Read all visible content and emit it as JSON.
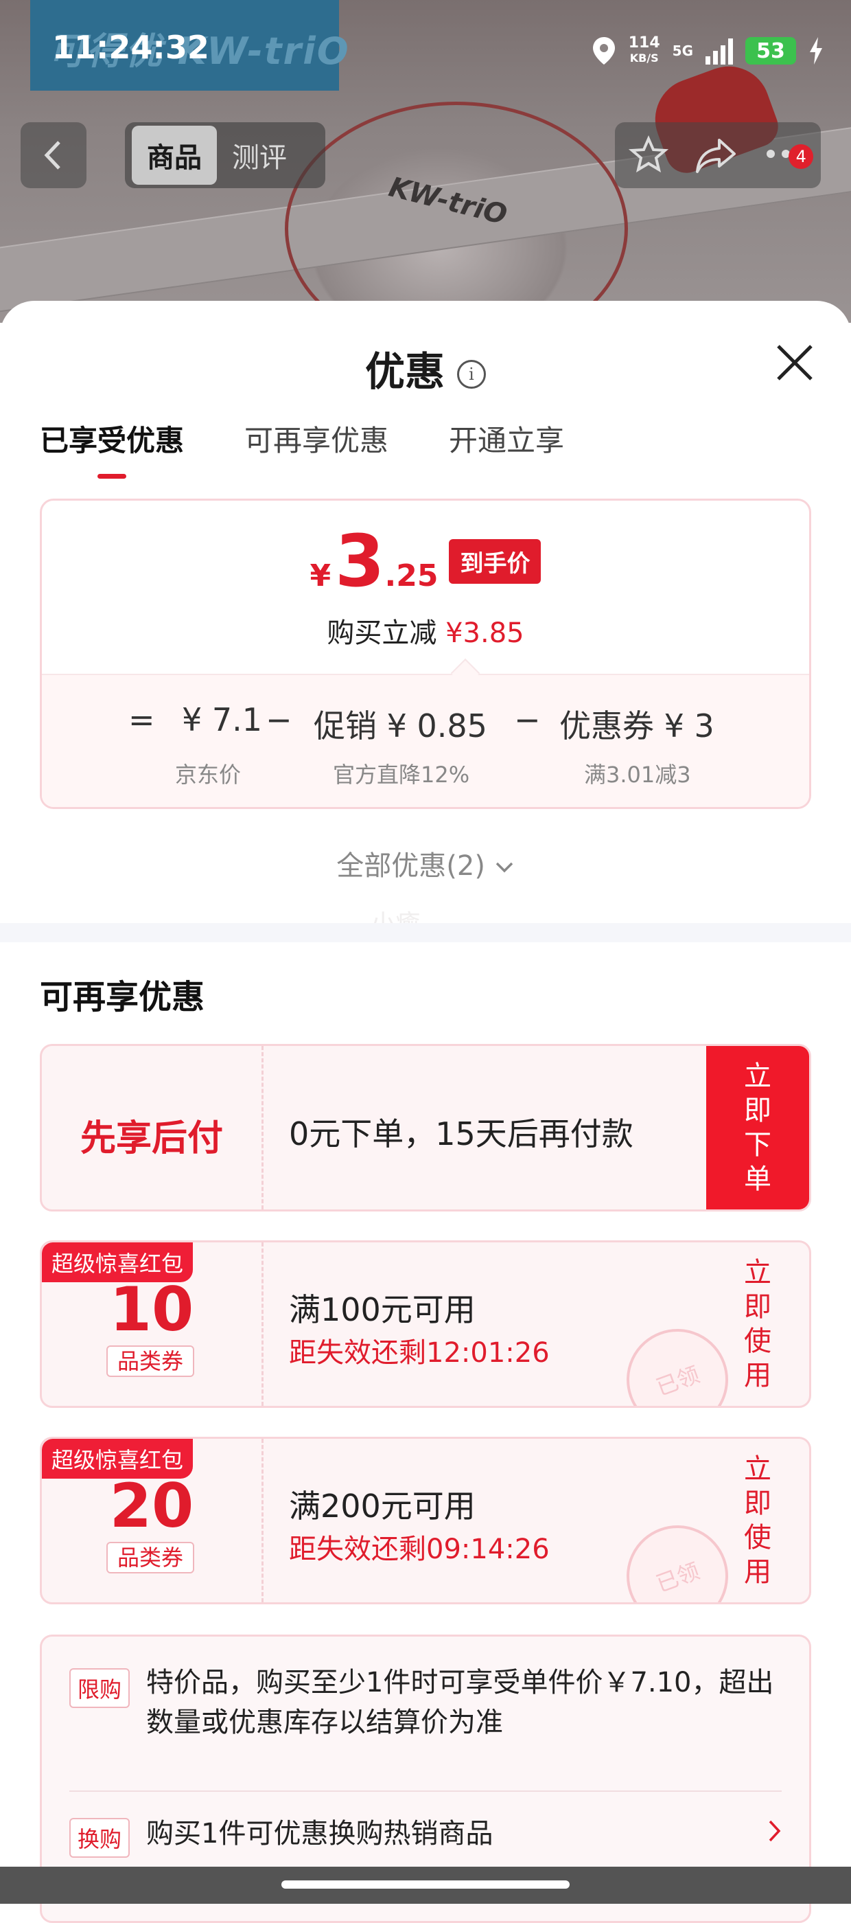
{
  "status_bar": {
    "time": "11:24:32",
    "net_speed": "114",
    "net_unit": "KB/S",
    "signal_label": "5G",
    "battery": "53"
  },
  "header": {
    "tabs": [
      "商品",
      "测评"
    ],
    "active_tab": "商品",
    "notification_count": "4",
    "brand_text": "可得优 KW-triO",
    "product_logo": "KW-triO"
  },
  "sheet": {
    "title": "优惠",
    "tabs": [
      "已享受优惠",
      "可再享优惠",
      "开通立享"
    ],
    "active_tab_index": 0
  },
  "price_card": {
    "currency": "¥",
    "price_int": "3",
    "price_dec": ".25",
    "price_tag": "到手价",
    "reduce_label": "购买立减",
    "reduce_amount": "¥3.85",
    "equals": "=",
    "minus": "−",
    "items": [
      {
        "value": "¥ 7.1",
        "label": "京东价"
      },
      {
        "value": "促销 ¥ 0.85",
        "label": "官方直降12%"
      },
      {
        "value": "优惠券 ¥ 3",
        "label": "满3.01减3"
      }
    ]
  },
  "all_offers": "全部优惠(2)",
  "watermark": "小癒",
  "extra_section": {
    "title": "可再享优惠",
    "pay_later": {
      "title": "先享后付",
      "desc": "0元下单，15天后再付款",
      "action": "立即下单"
    },
    "coupons": [
      {
        "tag": "超级惊喜红包",
        "amount": "10",
        "category": "品类券",
        "condition": "满100元可用",
        "countdown": "距失效还剩12:01:26",
        "action": "立即使用",
        "stamp": "已领"
      },
      {
        "tag": "超级惊喜红包",
        "amount": "20",
        "category": "品类券",
        "condition": "满200元可用",
        "countdown": "距失效还剩09:14:26",
        "action": "立即使用",
        "stamp": "已领"
      }
    ],
    "limit": {
      "tag": "限购",
      "text": "特价品，购买至少1件时可享受单件价￥7.10，超出数量或优惠库存以结算价为准"
    },
    "exchange": {
      "tag": "换购",
      "text": "购买1件可优惠换购热销商品"
    }
  },
  "colors": {
    "accent_red": "#e01c2c",
    "card_border": "#f8d4d9",
    "card_bg": "#fdf4f5",
    "battery_green": "#3cc14e"
  }
}
